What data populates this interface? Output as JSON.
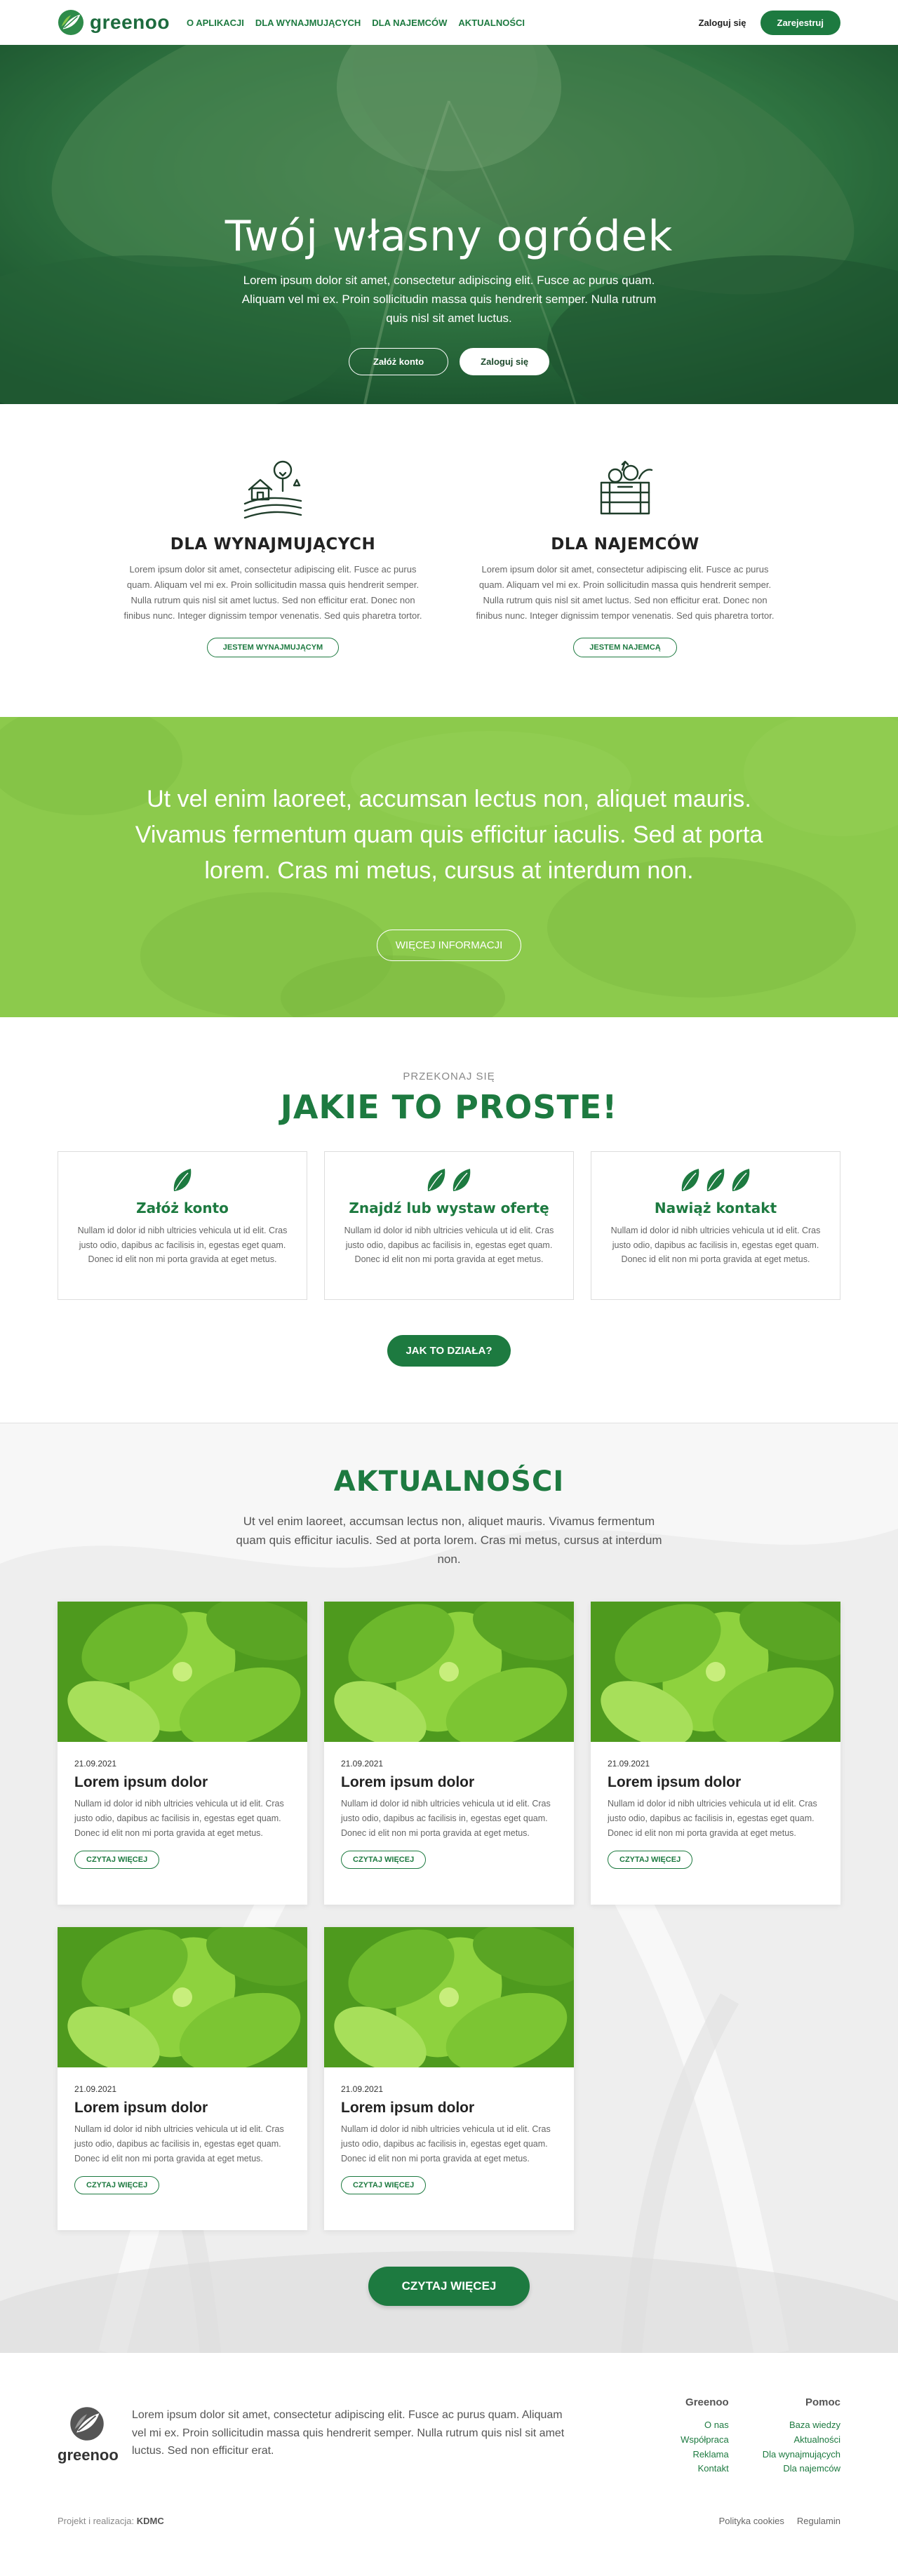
{
  "header": {
    "logo_text": "greenoo",
    "nav": [
      "O aplikacji",
      "Dla wynajmujących",
      "Dla najemców",
      "Aktualności"
    ],
    "login": "Zaloguj się",
    "register": "Zarejestruj"
  },
  "hero": {
    "title": "Twój własny ogródek",
    "text": "Lorem ipsum dolor sit amet, consectetur adipiscing elit. Fusce ac purus quam. Aliquam vel mi ex. Proin sollicitudin massa quis hendrerit semper. Nulla rutrum quis nisl sit amet luctus.",
    "btn_signup": "Załóż konto",
    "btn_login": "Zaloguj się"
  },
  "forwhom": {
    "landlords": {
      "title": "DLA WYNAJMUJĄCYCH",
      "text": "Lorem ipsum dolor sit amet, consectetur adipiscing elit. Fusce ac purus quam. Aliquam vel mi ex. Proin sollicitudin massa quis hendrerit semper. Nulla rutrum quis nisl sit amet luctus. Sed non efficitur erat. Donec non finibus nunc. Integer dignissim tempor venenatis. Sed quis pharetra tortor.",
      "button": "JESTEM WYNAJMUJĄCYM"
    },
    "tenants": {
      "title": "DLA NAJEMCÓW",
      "text": "Lorem ipsum dolor sit amet, consectetur adipiscing elit. Fusce ac purus quam. Aliquam vel mi ex. Proin sollicitudin massa quis hendrerit semper. Nulla rutrum quis nisl sit amet luctus. Sed non efficitur erat. Donec non finibus nunc. Integer dignissim tempor venenatis. Sed quis pharetra tortor.",
      "button": "JESTEM NAJEMCĄ"
    }
  },
  "banner": {
    "text": "Ut vel enim laoreet, accumsan lectus non, aliquet mauris. Vivamus fermentum quam quis efficitur iaculis. Sed at porta lorem. Cras mi metus, cursus at interdum non.",
    "button": "WIĘCEJ INFORMACJI"
  },
  "simple": {
    "eyebrow": "PRZEKONAJ SIĘ",
    "title": "JAKIE TO PROSTE!",
    "steps": [
      {
        "title": "Załóż konto",
        "leaves": 1,
        "text": "Nullam id dolor id nibh ultricies vehicula ut id elit. Cras justo odio, dapibus ac facilisis in, egestas eget quam. Donec id elit non mi porta gravida at eget metus."
      },
      {
        "title": "Znajdź lub wystaw ofertę",
        "leaves": 2,
        "text": "Nullam id dolor id nibh ultricies vehicula ut id elit. Cras justo odio, dapibus ac facilisis in, egestas eget quam. Donec id elit non mi porta gravida at eget metus."
      },
      {
        "title": "Nawiąż kontakt",
        "leaves": 3,
        "text": "Nullam id dolor id nibh ultricies vehicula ut id elit. Cras justo odio, dapibus ac facilisis in, egestas eget quam. Donec id elit non mi porta gravida at eget metus."
      }
    ],
    "button": "JAK TO DZIAŁA?"
  },
  "news": {
    "title": "AKTUALNOŚCI",
    "intro": "Ut vel enim laoreet, accumsan lectus non, aliquet mauris. Vivamus fermentum quam quis efficitur iaculis. Sed at porta lorem. Cras mi metus, cursus at interdum non.",
    "items": [
      {
        "date": "21.09.2021",
        "title": "Lorem ipsum dolor",
        "text": "Nullam id dolor id nibh ultricies vehicula ut id elit. Cras justo odio, dapibus ac facilisis in, egestas eget quam. Donec id elit non mi porta gravida at eget metus.",
        "button": "CZYTAJ WIĘCEJ"
      },
      {
        "date": "21.09.2021",
        "title": "Lorem ipsum dolor",
        "text": "Nullam id dolor id nibh ultricies vehicula ut id elit. Cras justo odio, dapibus ac facilisis in, egestas eget quam. Donec id elit non mi porta gravida at eget metus.",
        "button": "CZYTAJ WIĘCEJ"
      },
      {
        "date": "21.09.2021",
        "title": "Lorem ipsum dolor",
        "text": "Nullam id dolor id nibh ultricies vehicula ut id elit. Cras justo odio, dapibus ac facilisis in, egestas eget quam. Donec id elit non mi porta gravida at eget metus.",
        "button": "CZYTAJ WIĘCEJ"
      },
      {
        "date": "21.09.2021",
        "title": "Lorem ipsum dolor",
        "text": "Nullam id dolor id nibh ultricies vehicula ut id elit. Cras justo odio, dapibus ac facilisis in, egestas eget quam. Donec id elit non mi porta gravida at eget metus.",
        "button": "CZYTAJ WIĘCEJ"
      },
      {
        "date": "21.09.2021",
        "title": "Lorem ipsum dolor",
        "text": "Nullam id dolor id nibh ultricies vehicula ut id elit. Cras justo odio, dapibus ac facilisis in, egestas eget quam. Donec id elit non mi porta gravida at eget metus.",
        "button": "CZYTAJ WIĘCEJ"
      }
    ],
    "button": "CZYTAJ WIĘCEJ"
  },
  "footer": {
    "logo_text": "greenoo",
    "about": "Lorem ipsum dolor sit amet, consectetur adipiscing elit. Fusce ac purus quam. Aliquam vel mi ex. Proin sollicitudin massa quis hendrerit semper. Nulla rutrum quis nisl sit amet luctus. Sed non efficitur erat.",
    "col1": {
      "title": "Greenoo",
      "links": [
        "O nas",
        "Współpraca",
        "Reklama",
        "Kontakt"
      ]
    },
    "col2": {
      "title": "Pomoc",
      "links": [
        "Baza wiedzy",
        "Aktualności",
        "Dla wynajmujących",
        "Dla najemców"
      ]
    },
    "credit_prefix": "Projekt i realizacja:",
    "credit_name": "KDMC",
    "legal": [
      "Polityka cookies",
      "Regulamin"
    ]
  },
  "colors": {
    "brand": "#1d7a40",
    "banner": "#8cc84b",
    "hero": "#1e6b3a"
  },
  "icons": {
    "logo": "leaf-logo-icon",
    "landlords": "farm-house-icon",
    "tenants": "vegetable-crate-icon",
    "step": "leaf-icon"
  }
}
